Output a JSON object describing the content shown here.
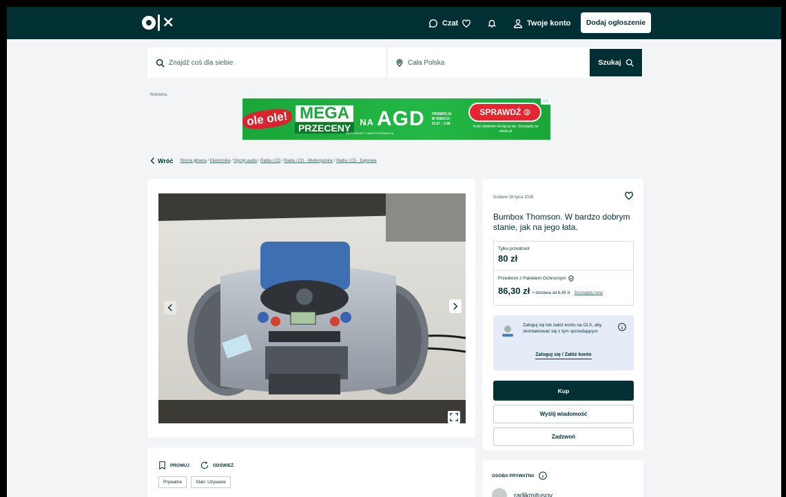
{
  "header": {
    "logo_text": "olx",
    "chat_label": "Czat",
    "account_label": "Twoje konto",
    "add_listing_label": "Dodaj ogłoszenie"
  },
  "search": {
    "query_placeholder": "Znajdź coś dla siebie",
    "location_value": "Cała Polska",
    "button_label": "Szukaj"
  },
  "ad": {
    "label": "Reklama",
    "brand": "ole ole!",
    "mega": "MEGA",
    "przeceny": "PRZECENY",
    "na": "NA",
    "agd": "AGD",
    "promo_line1": "PROMOCJA",
    "promo_line2": "W DNIACH:",
    "promo_dates": "21.07 - 3.08",
    "promo_sub": "NA PRODUKTY OBJĘTE PROMOCJĄ",
    "cta": "SPRAWDŹ",
    "footnote": "Kody rabatowe nie łączą się. Szczegóły na oleole.pl"
  },
  "breadcrumb": {
    "back_label": "Wróć",
    "items": [
      "Strona główna",
      "Elektronika",
      "Sprzęt audio",
      "Radia i CD",
      "Radia i CD - Wielkopolskie",
      "Radia i CD - Dąbrowa"
    ]
  },
  "listing": {
    "added_date": "Dodane 28 lipca 2025",
    "title": "Bumbox Thomson. W bardzo dobrym stanie, jak na jego łata.",
    "item_only_label": "Tylko przedmiot",
    "item_only_price": "80 zł",
    "protected_label": "Przedmiot z Pakietem Ochronnym",
    "protected_price": "86,30 zł",
    "shipping_text": "+ dostawa od 6,49 zł",
    "price_details_link": "Szczegóły ceny",
    "login_message": "Zaloguj się lub załóż konto na OLX, aby skontaktować się z tym sprzedającym",
    "login_link": "Zaloguj się / Załóż konto",
    "buy_label": "Kup",
    "message_label": "Wyślij wiadomość",
    "call_label": "Zadzwoń"
  },
  "details": {
    "promote_label": "PROMUJ",
    "refresh_label": "ODŚWIEŻ",
    "tags": [
      "Prywatne",
      "Stan: Używane"
    ]
  },
  "seller": {
    "type_label": "OSOBA PRYWATNA",
    "username": "radikmitusov"
  },
  "colors": {
    "brand_dark": "#002f34",
    "page_bg": "#f2f4f5",
    "login_box_bg": "#e6ecf7",
    "ad_green": "#23b845",
    "ad_red": "#e5252f"
  }
}
